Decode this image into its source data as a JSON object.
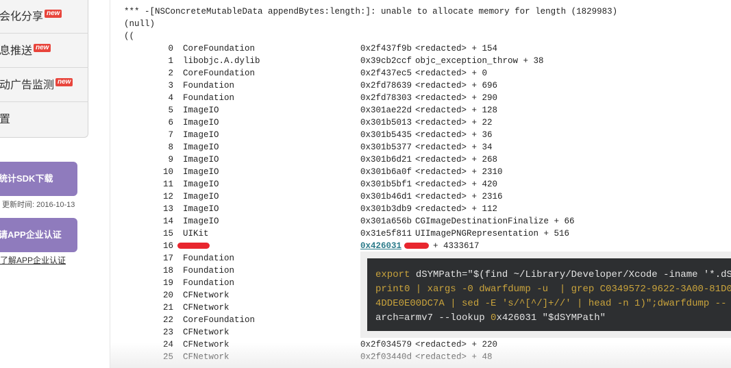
{
  "sidebar": {
    "menu": [
      {
        "label": "会化分享",
        "badge": "new"
      },
      {
        "label": "息推送",
        "badge": "new"
      },
      {
        "label": "动广告监测",
        "badge": "new"
      },
      {
        "label": "置",
        "badge": ""
      }
    ],
    "sdk_button": "统计SDK下载",
    "update_time": "更新时间: 2016-10-13",
    "cert_button": "请APP企业认证",
    "cert_link": "了解APP企业认证"
  },
  "log": {
    "error_line": "*** -[NSConcreteMutableData appendBytes:length:]: unable to allocate memory for length (1829983)",
    "null_line": "(null)",
    "open_line": "((",
    "frames": [
      {
        "n": "0",
        "lib": "CoreFoundation",
        "addr": "0x2f437f9b",
        "sym": "<redacted> + 154"
      },
      {
        "n": "1",
        "lib": "libobjc.A.dylib",
        "addr": "0x39cb2ccf",
        "sym": "objc_exception_throw + 38"
      },
      {
        "n": "2",
        "lib": "CoreFoundation",
        "addr": "0x2f437ec5",
        "sym": "<redacted> + 0"
      },
      {
        "n": "3",
        "lib": "Foundation",
        "addr": "0x2fd78639",
        "sym": "<redacted> + 696"
      },
      {
        "n": "4",
        "lib": "Foundation",
        "addr": "0x2fd78303",
        "sym": "<redacted> + 290"
      },
      {
        "n": "5",
        "lib": "ImageIO",
        "addr": "0x301ae22d",
        "sym": "<redacted> + 128"
      },
      {
        "n": "6",
        "lib": "ImageIO",
        "addr": "0x301b5013",
        "sym": "<redacted> + 22"
      },
      {
        "n": "7",
        "lib": "ImageIO",
        "addr": "0x301b5435",
        "sym": "<redacted> + 36"
      },
      {
        "n": "8",
        "lib": "ImageIO",
        "addr": "0x301b5377",
        "sym": "<redacted> + 34"
      },
      {
        "n": "9",
        "lib": "ImageIO",
        "addr": "0x301b6d21",
        "sym": "<redacted> + 268"
      },
      {
        "n": "10",
        "lib": "ImageIO",
        "addr": "0x301b6a0f",
        "sym": "<redacted> + 2310"
      },
      {
        "n": "11",
        "lib": "ImageIO",
        "addr": "0x301b5bf1",
        "sym": "<redacted> + 420"
      },
      {
        "n": "12",
        "lib": "ImageIO",
        "addr": "0x301b46d1",
        "sym": "<redacted> + 2316"
      },
      {
        "n": "13",
        "lib": "ImageIO",
        "addr": "0x301b3db9",
        "sym": "<redacted> + 112"
      },
      {
        "n": "14",
        "lib": "ImageIO",
        "addr": "0x301a656b",
        "sym": "CGImageDestinationFinalize + 66"
      },
      {
        "n": "15",
        "lib": "UIKit",
        "addr": "0x31e5f811",
        "sym": "UIImagePNGRepresentation + 516"
      },
      {
        "n": "16",
        "lib": "",
        "addr": "0x426031",
        "sym": "+ 4333617",
        "redacted": true
      },
      {
        "n": "17",
        "lib": "Foundation",
        "addr": "",
        "sym": ""
      },
      {
        "n": "18",
        "lib": "Foundation",
        "addr": "",
        "sym": ""
      },
      {
        "n": "19",
        "lib": "Foundation",
        "addr": "",
        "sym": ""
      },
      {
        "n": "20",
        "lib": "CFNetwork",
        "addr": "",
        "sym": ""
      },
      {
        "n": "21",
        "lib": "CFNetwork",
        "addr": "",
        "sym": ""
      },
      {
        "n": "22",
        "lib": "CoreFoundation",
        "addr": "",
        "sym": ""
      },
      {
        "n": "23",
        "lib": "CFNetwork",
        "addr": "",
        "sym": ""
      },
      {
        "n": "24",
        "lib": "CFNetwork",
        "addr": "0x2f034579",
        "sym": "<redacted> + 220"
      },
      {
        "n": "25",
        "lib": "CFNetwork",
        "addr": "0x2f03440d",
        "sym": "<redacted> + 48"
      }
    ]
  },
  "tooltip": {
    "lines": [
      [
        {
          "t": "export",
          "c": "kw"
        },
        {
          "t": " dSYMPath=\"$(find ~/Library/Developer/Xcode -iname '*.dS",
          "c": ""
        }
      ],
      [
        {
          "t": "print0 | xargs -0 dwarfdump -u  | grep C0349572-9622-3A00-81D0",
          "c": "kw"
        }
      ],
      [
        {
          "t": "4DDE0E00DC7A | sed -E 's/^[^/]+//' | head -n 1)\";dwarfdump --",
          "c": "kw"
        }
      ],
      [
        {
          "t": "arch=armv7 --lookup ",
          "c": ""
        },
        {
          "t": "0",
          "c": "kw"
        },
        {
          "t": "x426031 \"$dSYMPath\"",
          "c": ""
        }
      ]
    ]
  },
  "colors": {
    "accent_purple": "#8f7bbd",
    "badge_red": "#e8453c",
    "link_teal": "#2c7b8a",
    "code_bg": "#2d2f31"
  }
}
